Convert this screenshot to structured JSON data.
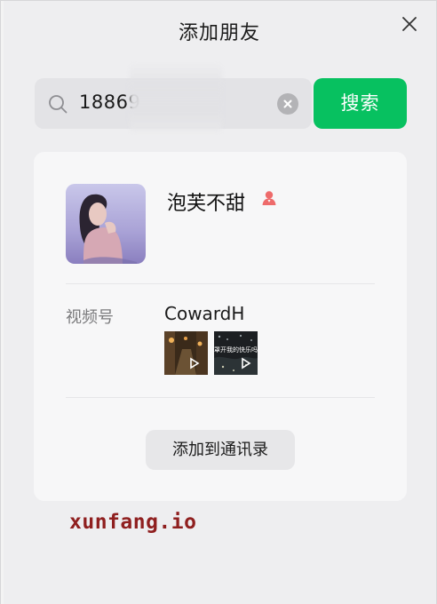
{
  "dialog": {
    "title": "添加朋友"
  },
  "search": {
    "value": "18869",
    "button_label": "搜索"
  },
  "profile": {
    "name": "泡芙不甜",
    "gender": "female",
    "gender_color": "#ee6b6b",
    "channels_label": "视频号",
    "channels_name": "CowardH",
    "thumb2_caption": "罩开我的快乐吗",
    "add_button_label": "添加到通讯录"
  },
  "watermark": "xunfang.io",
  "colors": {
    "accent": "#07c160",
    "watermark": "#8f1f1f"
  }
}
